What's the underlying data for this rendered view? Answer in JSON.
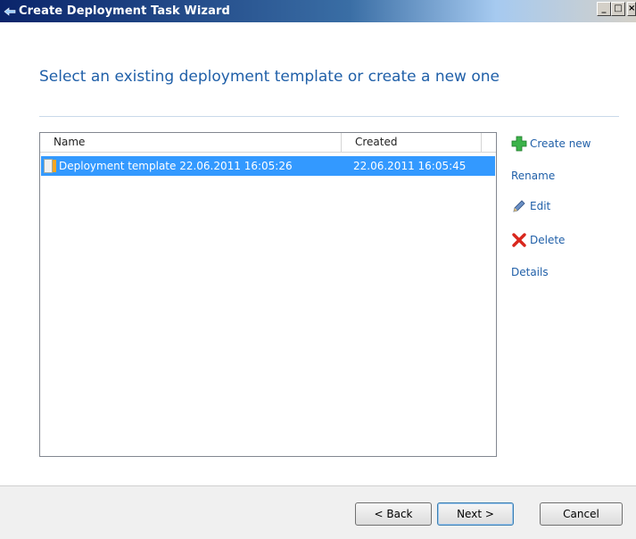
{
  "window": {
    "title": "Create Deployment Task Wizard",
    "controls": {
      "minimize": "_",
      "maximize": "□",
      "close": "×"
    }
  },
  "heading": "Select an existing deployment template or create a new one",
  "list": {
    "columns": [
      "Name",
      "Created"
    ],
    "rows": [
      {
        "name": "Deployment template 22.06.2011 16:05:26",
        "created": "22.06.2011 16:05:45",
        "selected": true
      }
    ]
  },
  "actions": {
    "create_new": "Create new",
    "rename": "Rename",
    "edit": "Edit",
    "delete": "Delete",
    "details": "Details"
  },
  "buttons": {
    "back": "< Back",
    "next": "Next >",
    "cancel": "Cancel"
  },
  "colors": {
    "accent": "#1f5fa8",
    "selection": "#3399ff",
    "create_icon": "#3cb34a",
    "delete_icon": "#d9261c"
  },
  "icons": {
    "title": "wizard-icon",
    "create": "plus-icon",
    "edit": "pencil-icon",
    "delete": "x-icon",
    "row": "document-icon"
  }
}
